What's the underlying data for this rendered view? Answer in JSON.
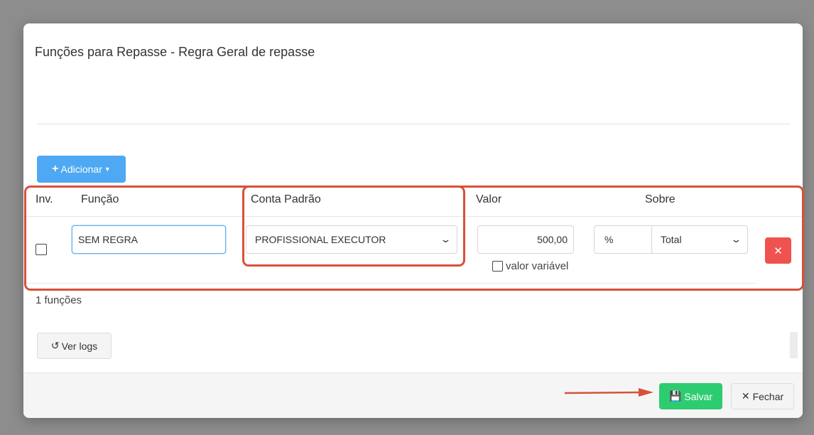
{
  "modal": {
    "title": "Funções para Repasse - Regra Geral de repasse",
    "add_button": {
      "label": "Adicionar",
      "icons": [
        "plus-icon",
        "chevron-down-icon"
      ]
    },
    "table": {
      "headers": {
        "inv": "Inv.",
        "funcao": "Função",
        "conta_padrao": "Conta Padrão",
        "valor": "Valor",
        "sobre": "Sobre"
      },
      "rows": [
        {
          "inv_checked": false,
          "funcao": "SEM REGRA",
          "conta_padrao": "PROFISSIONAL EXECUTOR",
          "valor": "500,00",
          "valor_variavel_label": "valor variável",
          "valor_variavel_checked": false,
          "unidade": "%",
          "sobre": "Total"
        }
      ]
    },
    "count_text": "1 funções",
    "logs_button": "Ver logs",
    "footer": {
      "save": "Salvar",
      "close": "Fechar"
    }
  },
  "colors": {
    "add_button": "#4ea8f3",
    "save_button": "#2ecc71",
    "delete_button": "#ef5350",
    "annotation": "#d9503a"
  }
}
